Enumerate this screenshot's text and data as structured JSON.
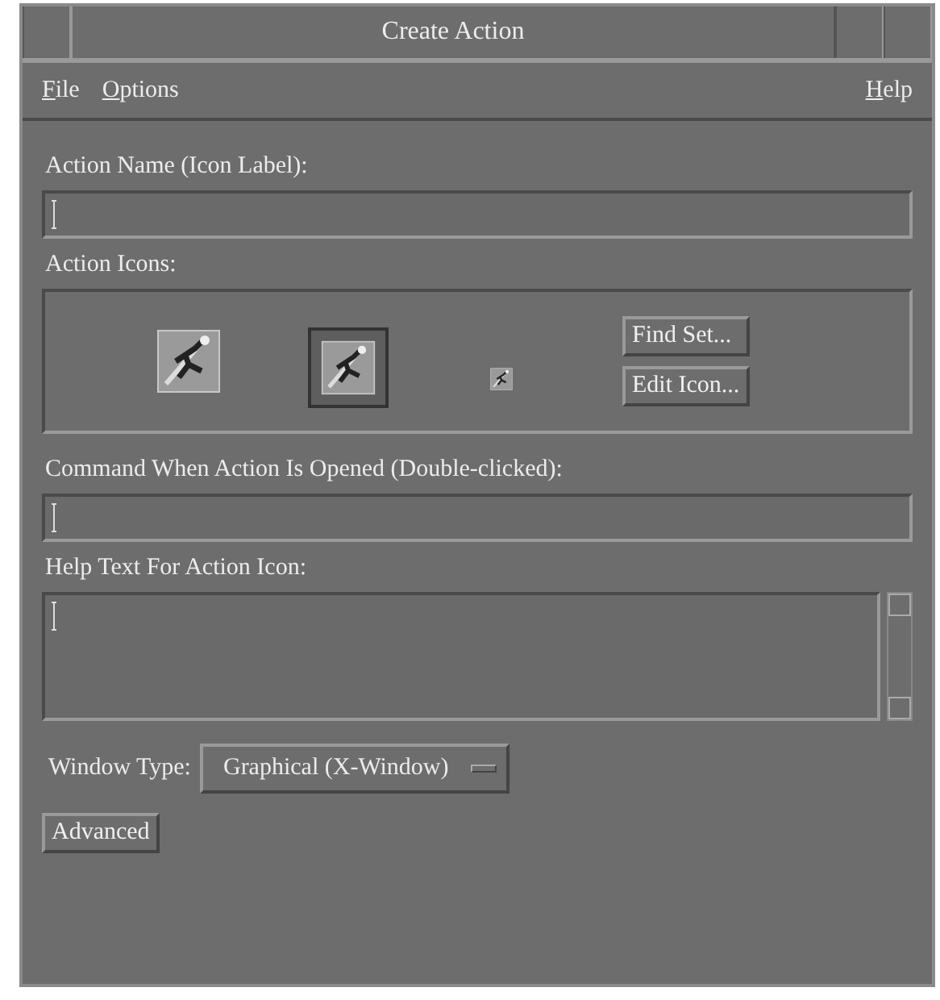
{
  "window": {
    "title": "Create Action"
  },
  "menu": [
    "File",
    "Options"
  ],
  "help_menu": "Help",
  "action_name": {
    "label": "Action Name (Icon Label):"
  },
  "action_icons": {
    "label": "Action Icons:",
    "icons": [
      {
        "selected": false
      },
      {
        "selected": true
      },
      {
        "selected": false
      }
    ],
    "buttons": [
      "Find Set...",
      "Edit Icon..."
    ]
  },
  "command": {
    "label": "Command When Action Is Opened (Double-clicked):"
  },
  "help_text": {
    "label": "Help Text For Action Icon:"
  },
  "window_type": {
    "label": "Window Type:",
    "value": "Graphical (X-Window)"
  },
  "buttons": [
    "Advanced"
  ]
}
